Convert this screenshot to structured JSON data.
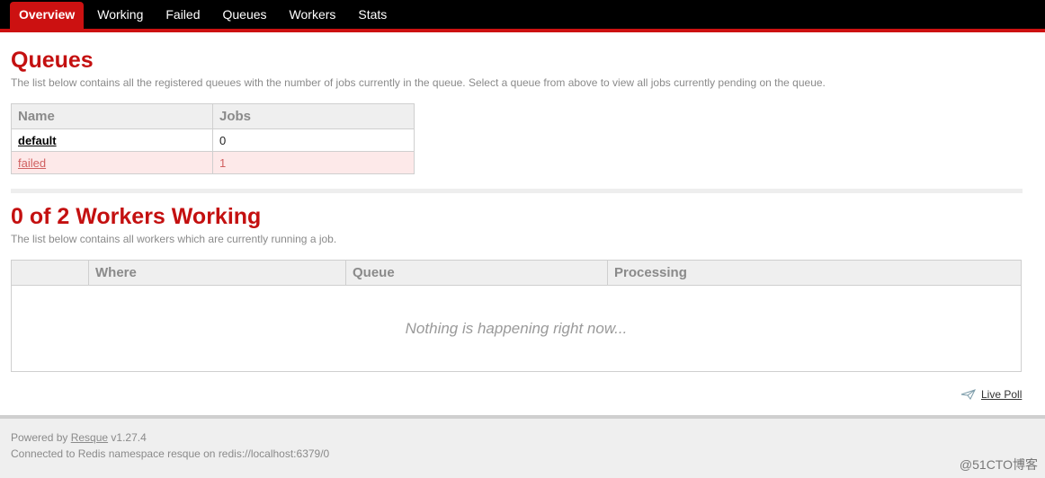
{
  "nav": {
    "tabs": [
      {
        "label": "Overview",
        "active": true
      },
      {
        "label": "Working",
        "active": false
      },
      {
        "label": "Failed",
        "active": false
      },
      {
        "label": "Queues",
        "active": false
      },
      {
        "label": "Workers",
        "active": false
      },
      {
        "label": "Stats",
        "active": false
      }
    ]
  },
  "queues": {
    "title": "Queues",
    "description": "The list below contains all the registered queues with the number of jobs currently in the queue. Select a queue from above to view all jobs currently pending on the queue.",
    "columns": [
      "Name",
      "Jobs"
    ],
    "rows": [
      {
        "name": "default",
        "jobs": "0"
      },
      {
        "name": "failed",
        "jobs": "1"
      }
    ]
  },
  "workers": {
    "title": "0 of 2 Workers Working",
    "description": "The list below contains all workers which are currently running a job.",
    "columns": [
      "",
      "Where",
      "Queue",
      "Processing"
    ],
    "empty_message": "Nothing is happening right now..."
  },
  "live_poll": {
    "label": "Live Poll",
    "icon": "paper-plane-icon"
  },
  "footer": {
    "powered_prefix": "Powered by ",
    "resque_link": "Resque",
    "version": " v1.27.4",
    "connection": "Connected to Redis namespace resque on redis://localhost:6379/0",
    "watermark": "@51CTO博客"
  },
  "colors": {
    "accent": "#cc1111",
    "heading": "#c41010",
    "failed_row": "#fde9e9"
  }
}
